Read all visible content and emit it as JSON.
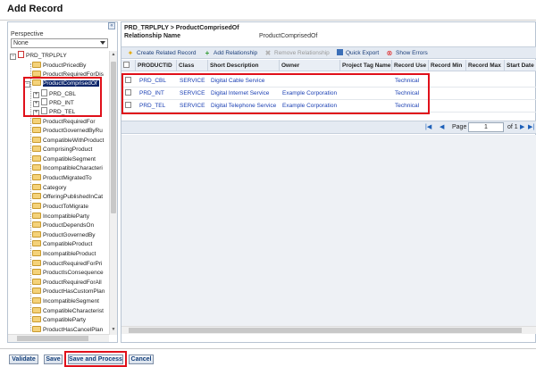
{
  "title": "Add Record",
  "left_panel": {
    "collapse_glyph": "«",
    "perspective_label": "Perspective",
    "perspective_value": "None",
    "root_node": "PRD_TRPLPLY",
    "nodes": [
      "ProductPricedBy",
      "ProductRequiredForDis",
      "ProductComprisedOf",
      "PRD_CBL",
      "PRD_INT",
      "PRD_TEL",
      "ProductRequiredFor",
      "ProductGovernedByRu",
      "CompatibleWithProduct",
      "ComprisingProduct",
      "CompatibleSegment",
      "IncompatibleCharacteri",
      "ProductMigratedTo",
      "Category",
      "OfferingPublishedInCat",
      "ProductToMigrate",
      "IncompatibleParty",
      "ProductDependsOn",
      "ProductGovernedBy",
      "CompatibleProduct",
      "IncompatibleProduct",
      "ProductRequiredForPri",
      "ProductIsConsequence",
      "ProductRequiredForAll",
      "ProductHasCustomPlan",
      "IncompatibleSegment",
      "CompatibleCharacterist",
      "CompatibleParty",
      "ProductHasCancelPlan"
    ]
  },
  "right_panel": {
    "breadcrumb": "PRD_TRPLPLY > ProductComprisedOf",
    "relationship_name_label": "Relationship Name",
    "relationship_name_value": "ProductComprisedOf",
    "toolbar": {
      "create_related": "Create Related Record",
      "add_relationship": "Add Relationship",
      "remove_relationship": "Remove Relationship",
      "quick_export": "Quick Export",
      "show_errors": "Show Errors"
    },
    "columns": [
      "",
      "PRODUCTID",
      "Class",
      "Short Description",
      "Owner",
      "Project Tag Name",
      "Record Use",
      "Record Min",
      "Record Max",
      "Start Date"
    ],
    "rows": [
      {
        "id": "PRD_CBL",
        "class": "SERVICE",
        "desc": "Digital Cable Service",
        "owner": "",
        "tag": "",
        "use": "Technical"
      },
      {
        "id": "PRD_INT",
        "class": "SERVICE",
        "desc": "Digital Internet Service",
        "owner": "Example Corporation",
        "tag": "",
        "use": "Technical"
      },
      {
        "id": "PRD_TEL",
        "class": "SERVICE",
        "desc": "Digital Telephone Service",
        "owner": "Example Corporation",
        "tag": "",
        "use": "Technical"
      }
    ],
    "pager": {
      "page_label": "Page",
      "page_value": "1",
      "of_label": "of 1"
    }
  },
  "buttons": {
    "validate": "Validate",
    "save": "Save",
    "save_and_process": "Save and Process",
    "cancel": "Cancel"
  },
  "colors": {
    "highlight": "#e0101a",
    "selection": "#0a246a",
    "link": "#1a3fb3"
  }
}
